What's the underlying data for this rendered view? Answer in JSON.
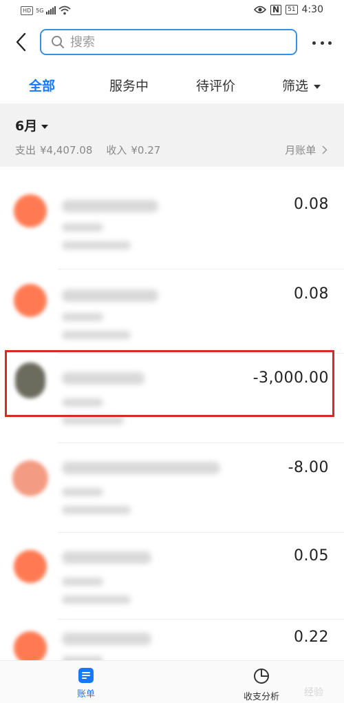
{
  "status_bar": {
    "hd": "HD",
    "network": "5G",
    "nfc": "N",
    "battery": "51",
    "time": "4:30"
  },
  "search": {
    "placeholder": "搜索",
    "value": ""
  },
  "tabs": [
    {
      "label": "全部",
      "active": true
    },
    {
      "label": "服务中",
      "active": false
    },
    {
      "label": "待评价",
      "active": false
    },
    {
      "label": "筛选",
      "active": false
    }
  ],
  "month": {
    "label": "6月",
    "expense_label": "支出",
    "expense_value": "¥4,407.08",
    "income_label": "收入",
    "income_value": "¥0.27",
    "monthly_bill": "月账单"
  },
  "transactions": [
    {
      "amount": "0.08",
      "avatar_color": "#ff7a52"
    },
    {
      "amount": "0.08",
      "avatar_color": "#ff7a52"
    },
    {
      "amount": "-3,000.00",
      "avatar_color": "#6b6b5e",
      "highlighted": true
    },
    {
      "amount": "-8.00",
      "avatar_color": "#f39b83"
    },
    {
      "amount": "0.05",
      "avatar_color": "#ff7a52"
    },
    {
      "amount": "0.22",
      "avatar_color": "#ff7a52"
    }
  ],
  "bottom_nav": {
    "bill_label": "账单",
    "analysis_label": "收支分析"
  },
  "watermark": "经验",
  "colors": {
    "accent": "#1677ff",
    "highlight": "#d42a2a",
    "search_border": "#3a8fd9"
  }
}
